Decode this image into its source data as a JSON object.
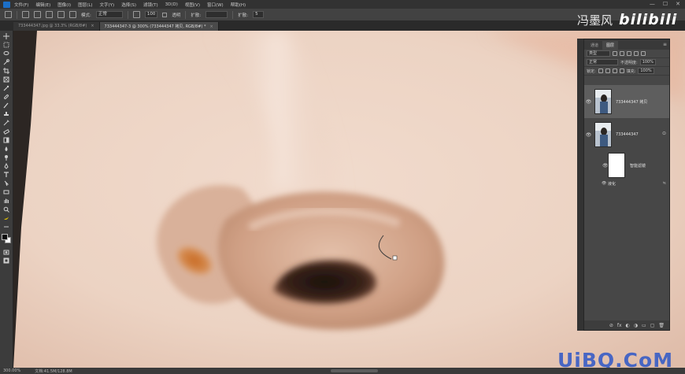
{
  "menubar": {
    "items": [
      "文件(F)",
      "编辑(E)",
      "图像(I)",
      "图层(L)",
      "文字(Y)",
      "选择(S)",
      "滤镜(T)",
      "3D(D)",
      "视图(V)",
      "窗口(W)",
      "帮助(H)"
    ],
    "minimize": "—",
    "maximize": "☐",
    "close": "✕"
  },
  "options": {
    "mode_label": "模式:",
    "mode_value": "正常",
    "opacity_value": "100",
    "check_label": "透明",
    "diffusion_label": "扩散:",
    "diffusion_value": "",
    "diffusion2_label": "扩散:",
    "diffusion2_value": "5"
  },
  "watermark": {
    "name": "冯墨风",
    "brand": "bilibili",
    "site": "UiBQ.CoM"
  },
  "tabs": [
    {
      "label": "733444347.jpg @ 33.3% (RGB/8#)",
      "active": false
    },
    {
      "label": "733444347-3 @ 300% (733444347 拷贝, RGB/8#) *",
      "active": true
    }
  ],
  "status": {
    "zoom": "300.00%",
    "doc": "文档:41.5M/128.8M"
  },
  "layers_panel": {
    "tabs": [
      "通道",
      "图层"
    ],
    "menu": "≡",
    "filter_kind": "类型",
    "blend_mode": "正常",
    "opacity_label": "不透明度:",
    "opacity_value": "100%",
    "lock_label": "锁定:",
    "fill_label": "填充:",
    "fill_value": "100%",
    "layers": [
      {
        "name": "733444347 拷贝",
        "selected": true,
        "visible": "👁"
      },
      {
        "name": "733444347",
        "selected": false,
        "visible": "👁",
        "badge": "⊙"
      }
    ],
    "smart_filter": {
      "title": "智能滤镜",
      "item": "液化",
      "eye": "👁",
      "option": "≒"
    },
    "footer_icons": [
      "⊘",
      "fx",
      "◐",
      "◑",
      "▭",
      "▢",
      "🗑"
    ]
  }
}
